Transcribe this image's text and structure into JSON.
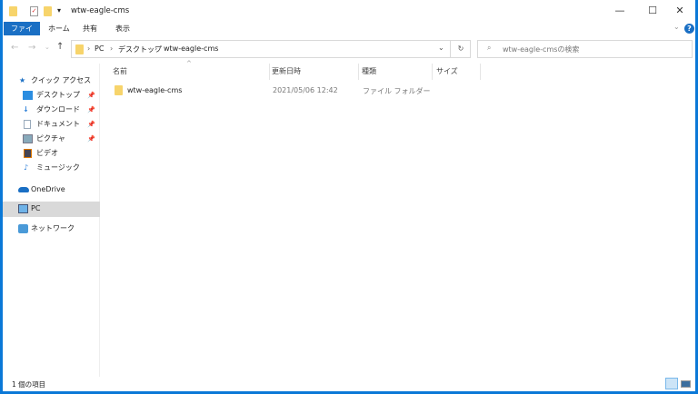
{
  "window": {
    "title": "wtw-eagle-cms",
    "controls": {
      "minimize": "—",
      "maximize": "☐",
      "close": "✕"
    }
  },
  "ribbon": {
    "tabs": [
      "ファイル",
      "ホーム",
      "共有",
      "表示"
    ]
  },
  "address": {
    "path": [
      "PC",
      "デスクトップ",
      "wtw-eagle-cms"
    ],
    "search_placeholder": "wtw-eagle-cmsの検索"
  },
  "nav": {
    "quick_access": "クイック アクセス",
    "items": [
      {
        "label": "デスクトップ",
        "icon": "desktop-icon",
        "pinned": true
      },
      {
        "label": "ダウンロード",
        "icon": "download-icon",
        "pinned": true
      },
      {
        "label": "ドキュメント",
        "icon": "document-icon",
        "pinned": true
      },
      {
        "label": "ピクチャ",
        "icon": "picture-icon",
        "pinned": true
      },
      {
        "label": "ビデオ",
        "icon": "video-icon",
        "pinned": false
      },
      {
        "label": "ミュージック",
        "icon": "music-icon",
        "pinned": false
      }
    ],
    "onedrive": "OneDrive",
    "pc": "PC",
    "network": "ネットワーク"
  },
  "columns": [
    "名前",
    "更新日時",
    "種類",
    "サイズ"
  ],
  "files": [
    {
      "name": "wtw-eagle-cms",
      "modified": "2021/05/06 12:42",
      "type": "ファイル フォルダー",
      "size": ""
    }
  ],
  "status": "1 個の項目",
  "colors": {
    "accent": "#0a78d7",
    "selected": "#d9d9d9"
  }
}
